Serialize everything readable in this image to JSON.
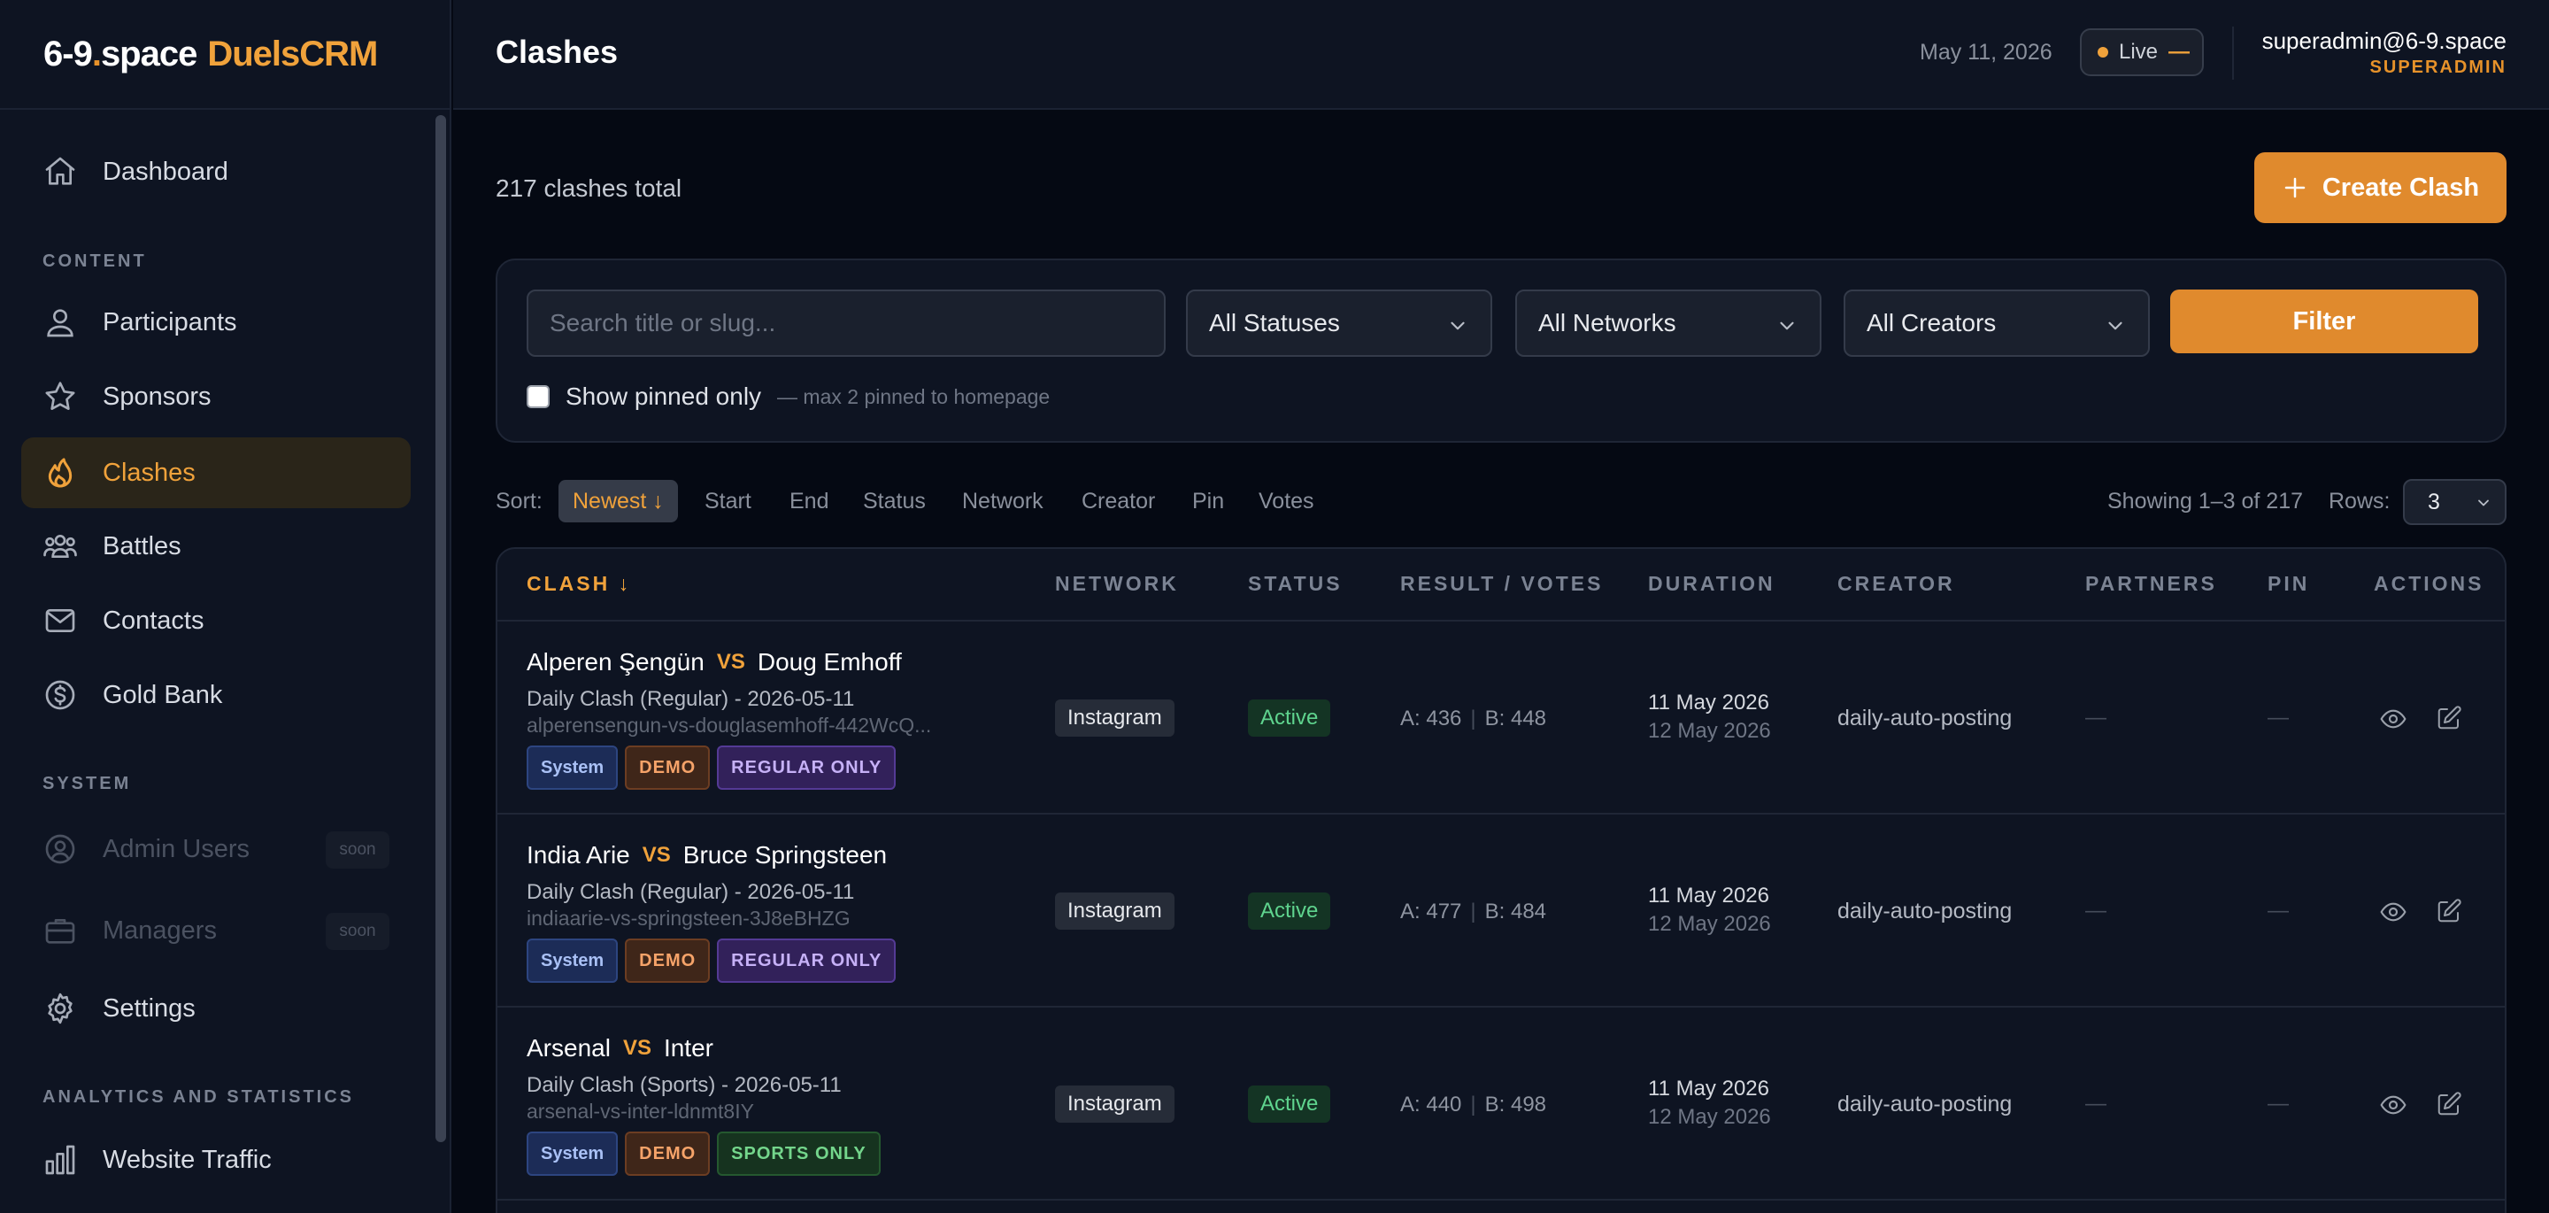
{
  "brand": {
    "part1": "6-9",
    "dot": ".",
    "part2": "space",
    "part3": "DuelsCRM"
  },
  "sidebar": {
    "items": [
      {
        "label": "Dashboard",
        "icon": "home-icon"
      },
      {
        "label": "Participants",
        "icon": "user-icon"
      },
      {
        "label": "Sponsors",
        "icon": "star-icon"
      },
      {
        "label": "Clashes",
        "icon": "flame-icon"
      },
      {
        "label": "Battles",
        "icon": "users-icon"
      },
      {
        "label": "Contacts",
        "icon": "mail-icon"
      },
      {
        "label": "Gold Bank",
        "icon": "dollar-icon"
      },
      {
        "label": "Admin Users",
        "icon": "user-circle-icon",
        "badge": "soon"
      },
      {
        "label": "Managers",
        "icon": "briefcase-icon",
        "badge": "soon"
      },
      {
        "label": "Settings",
        "icon": "gear-icon"
      },
      {
        "label": "Website Traffic",
        "icon": "bar-chart-icon"
      }
    ],
    "sections": {
      "content": "CONTENT",
      "system": "SYSTEM",
      "analytics": "ANALYTICS AND STATISTICS"
    }
  },
  "header": {
    "title": "Clashes",
    "date": "May 11, 2026",
    "live_label": "Live",
    "live_dash": "—",
    "user_email": "superadmin@6-9.space",
    "user_role": "SUPERADMIN"
  },
  "main": {
    "total": "217 clashes total",
    "create_label": "Create Clash"
  },
  "filters": {
    "search_placeholder": "Search title or slug...",
    "status": "All Statuses",
    "network": "All Networks",
    "creator": "All Creators",
    "filter_label": "Filter",
    "pinned_label": "Show pinned only",
    "pinned_note": "— max 2 pinned to homepage"
  },
  "sort": {
    "label": "Sort:",
    "options": [
      "Newest ↓",
      "Start",
      "End",
      "Status",
      "Network",
      "Creator",
      "Pin",
      "Votes"
    ],
    "showing": "Showing 1–3 of 217",
    "rows_label": "Rows:",
    "rows_value": "3"
  },
  "table": {
    "headers": [
      "CLASH ↓",
      "NETWORK",
      "STATUS",
      "RESULT / VOTES",
      "DURATION",
      "CREATOR",
      "PARTNERS",
      "PIN",
      "ACTIONS"
    ],
    "rows": [
      {
        "a": "Alperen Şengün",
        "vs": "VS",
        "b": "Doug Emhoff",
        "sub": "Daily Clash (Regular) - 2026-05-11",
        "slug": "alperensengun-vs-douglasemhoff-442WcQ...",
        "tags": [
          "System",
          "DEMO",
          "REGULAR ONLY"
        ],
        "network": "Instagram",
        "status": "Active",
        "votes_a": "A: 436",
        "votes_sep": "|",
        "votes_b": "B: 448",
        "start": "11 May 2026",
        "end": "12 May 2026",
        "creator": "daily-auto-posting",
        "partners": "—",
        "pin": "—"
      },
      {
        "a": "India Arie",
        "vs": "VS",
        "b": "Bruce Springsteen",
        "sub": "Daily Clash (Regular) - 2026-05-11",
        "slug": "indiaarie-vs-springsteen-3J8eBHZG",
        "tags": [
          "System",
          "DEMO",
          "REGULAR ONLY"
        ],
        "network": "Instagram",
        "status": "Active",
        "votes_a": "A: 477",
        "votes_sep": "|",
        "votes_b": "B: 484",
        "start": "11 May 2026",
        "end": "12 May 2026",
        "creator": "daily-auto-posting",
        "partners": "—",
        "pin": "—"
      },
      {
        "a": "Arsenal",
        "vs": "VS",
        "b": "Inter",
        "sub": "Daily Clash (Sports) - 2026-05-11",
        "slug": "arsenal-vs-inter-ldnmt8IY",
        "tags": [
          "System",
          "DEMO",
          "SPORTS ONLY"
        ],
        "network": "Instagram",
        "status": "Active",
        "votes_a": "A: 440",
        "votes_sep": "|",
        "votes_b": "B: 498",
        "start": "11 May 2026",
        "end": "12 May 2026",
        "creator": "daily-auto-posting",
        "partners": "—",
        "pin": "—"
      }
    ]
  },
  "colors": {
    "accent": "#e08a2d",
    "accent_text": "#f0a23b",
    "bg": "#050913",
    "panel": "#0e1422",
    "active_green": "#5fd48e"
  }
}
